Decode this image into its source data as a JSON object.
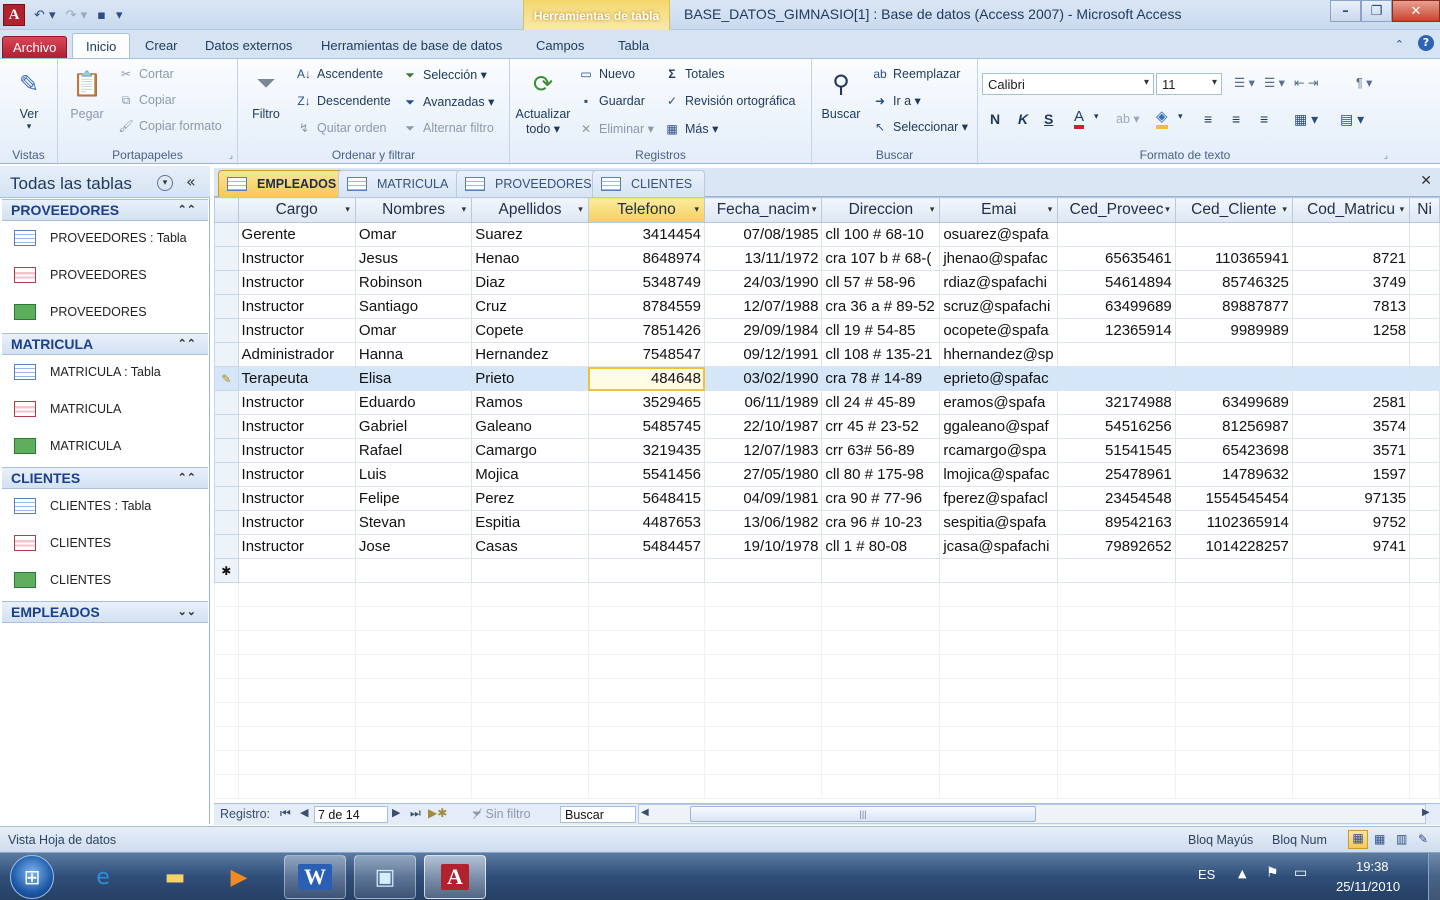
{
  "window": {
    "title": "BASE_DATOS_GIMNASIO[1] : Base de datos (Access 2007)  -  Microsoft Access",
    "context_tools_title": "Herramientas de tabla"
  },
  "ribbon_tabs": [
    "Archivo",
    "Inicio",
    "Crear",
    "Datos externos",
    "Herramientas de base de datos",
    "Campos",
    "Tabla"
  ],
  "ribbon": {
    "vistas": {
      "label": "Vistas",
      "ver": "Ver"
    },
    "portapapeles": {
      "label": "Portapapeles",
      "pegar": "Pegar",
      "cortar": "Cortar",
      "copiar": "Copiar",
      "copiar_formato": "Copiar formato"
    },
    "ordenar": {
      "label": "Ordenar y filtrar",
      "filtro": "Filtro",
      "ascendente": "Ascendente",
      "descendente": "Descendente",
      "quitar_orden": "Quitar orden",
      "seleccion": "Selección",
      "avanzadas": "Avanzadas",
      "alternar_filtro": "Alternar filtro"
    },
    "registros": {
      "label": "Registros",
      "actualizar": "Actualizar",
      "actualizar2": "todo",
      "nuevo": "Nuevo",
      "guardar": "Guardar",
      "eliminar": "Eliminar",
      "totales": "Totales",
      "revision": "Revisión ortográfica",
      "mas": "Más"
    },
    "buscar": {
      "label": "Buscar",
      "buscar": "Buscar",
      "reemplazar": "Reemplazar",
      "ir_a": "Ir a",
      "seleccionar": "Seleccionar"
    },
    "formato": {
      "label": "Formato de texto",
      "font": "Calibri",
      "size": "11"
    }
  },
  "nav": {
    "title": "Todas las tablas",
    "sections": [
      {
        "name": "PROVEEDORES",
        "items": [
          "PROVEEDORES : Tabla",
          "PROVEEDORES",
          "PROVEEDORES"
        ]
      },
      {
        "name": "MATRICULA",
        "items": [
          "MATRICULA : Tabla",
          "MATRICULA",
          "MATRICULA"
        ]
      },
      {
        "name": "CLIENTES",
        "items": [
          "CLIENTES : Tabla",
          "CLIENTES",
          "CLIENTES"
        ]
      },
      {
        "name": "EMPLEADOS",
        "items": []
      }
    ]
  },
  "doc_tabs": [
    "EMPLEADOS",
    "MATRICULA",
    "PROVEEDORES",
    "CLIENTES"
  ],
  "grid": {
    "columns": [
      "Cargo",
      "Nombres",
      "Apellidos",
      "Telefono",
      "Fecha_nacim",
      "Direccion",
      "Emai",
      "Ced_Proveec",
      "Ced_Cliente",
      "Cod_Matricu",
      "Ni"
    ],
    "rows": [
      [
        "Gerente",
        "Omar",
        "Suarez",
        "3414454",
        "07/08/1985",
        "cll 100 # 68-10",
        "osuarez@spafa",
        "",
        "",
        "",
        ""
      ],
      [
        "Instructor",
        "Jesus",
        "Henao",
        "8648974",
        "13/11/1972",
        "cra 107 b # 68-(",
        "jhenao@spafac",
        "65635461",
        "110365941",
        "8721",
        ""
      ],
      [
        "Instructor",
        "Robinson",
        "Diaz",
        "5348749",
        "24/03/1990",
        "cll 57 # 58-96",
        "rdiaz@spafachi",
        "54614894",
        "85746325",
        "3749",
        ""
      ],
      [
        "Instructor",
        "Santiago",
        "Cruz",
        "8784559",
        "12/07/1988",
        "cra 36 a # 89-52",
        "scruz@spafachi",
        "63499689",
        "89887877",
        "7813",
        ""
      ],
      [
        "Instructor",
        "Omar",
        "Copete",
        "7851426",
        "29/09/1984",
        "cll 19 # 54-85",
        "ocopete@spafa",
        "12365914",
        "9989989",
        "1258",
        ""
      ],
      [
        "Administrador",
        "Hanna",
        "Hernandez",
        "7548547",
        "09/12/1991",
        "cll 108 # 135-21",
        "hhernandez@sp",
        "",
        "",
        "",
        ""
      ],
      [
        "Terapeuta",
        "Elisa",
        "Prieto",
        "484648",
        "03/02/1990",
        "cra 78 # 14-89",
        "eprieto@spafac",
        "",
        "",
        "",
        ""
      ],
      [
        "Instructor",
        "Eduardo",
        "Ramos",
        "3529465",
        "06/11/1989",
        "cll 24 # 45-89",
        "eramos@spafa",
        "32174988",
        "63499689",
        "2581",
        ""
      ],
      [
        "Instructor",
        "Gabriel",
        "Galeano",
        "5485745",
        "22/10/1987",
        "crr 45 # 23-52",
        "ggaleano@spaf",
        "54516256",
        "81256987",
        "3574",
        ""
      ],
      [
        "Instructor",
        "Rafael",
        "Camargo",
        "3219435",
        "12/07/1983",
        "crr 63# 56-89",
        "rcamargo@spa",
        "51541545",
        "65423698",
        "3571",
        ""
      ],
      [
        "Instructor",
        "Luis",
        "Mojica",
        "5541456",
        "27/05/1980",
        "cll 80 # 175-98",
        "lmojica@spafac",
        "25478961",
        "14789632",
        "1597",
        ""
      ],
      [
        "Instructor",
        "Felipe",
        "Perez",
        "5648415",
        "04/09/1981",
        "cra 90 # 77-96",
        "fperez@spafacl",
        "23454548",
        "1554545454",
        "97135",
        ""
      ],
      [
        "Instructor",
        "Stevan",
        "Espitia",
        "4487653",
        "13/06/1982",
        "cra 96 # 10-23",
        "sespitia@spafa",
        "89542163",
        "1102365914",
        "9752",
        ""
      ],
      [
        "Instructor",
        "Jose",
        "Casas",
        "5484457",
        "19/10/1978",
        "cll 1 # 80-08",
        "jcasa@spafachi",
        "79892652",
        "1014228257",
        "9741",
        ""
      ]
    ],
    "current_row": 6,
    "selected_column": 3
  },
  "record_nav": {
    "label": "Registro:",
    "position": "7 de 14",
    "filter": "Sin filtro",
    "search": "Buscar"
  },
  "status": {
    "left": "Vista Hoja de datos",
    "caps": "Bloq Mayús",
    "num": "Bloq Num"
  },
  "taskbar": {
    "lang": "ES",
    "time": "19:38",
    "date": "25/11/2010"
  }
}
